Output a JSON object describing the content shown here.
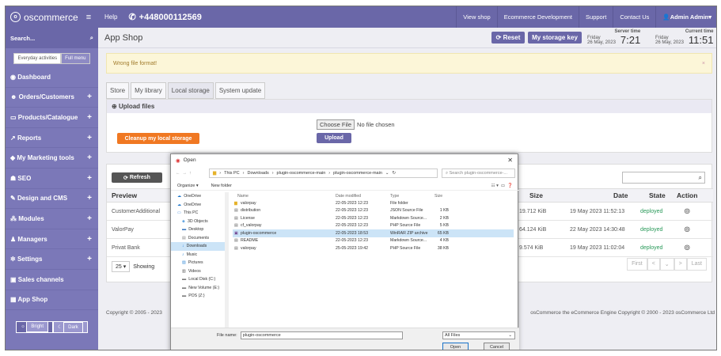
{
  "topbar": {
    "brand": "oscommerce",
    "menu_icon": "hamburger-icon",
    "help": "Help",
    "phone": "+448000112569",
    "links": [
      "View shop",
      "Ecommerce Development",
      "Support",
      "Contact Us",
      "Admin Admin"
    ]
  },
  "sidebar": {
    "search": "Search...",
    "activity_tabs": [
      "Everyday activities",
      "Full menu"
    ],
    "items": [
      {
        "label": "Dashboard",
        "icon": "dashboard-icon",
        "plus": false
      },
      {
        "label": "Orders/Customers",
        "icon": "users-icon",
        "plus": true
      },
      {
        "label": "Products/Catalogue",
        "icon": "folder-icon",
        "plus": true
      },
      {
        "label": "Reports",
        "icon": "chart-icon",
        "plus": true
      },
      {
        "label": "My Marketing tools",
        "icon": "tag-icon",
        "plus": true
      },
      {
        "label": "SEO",
        "icon": "sitemap-icon",
        "plus": true
      },
      {
        "label": "Design and CMS",
        "icon": "brush-icon",
        "plus": true
      },
      {
        "label": "Modules",
        "icon": "modules-icon",
        "plus": true
      },
      {
        "label": "Managers",
        "icon": "user-icon",
        "plus": true
      },
      {
        "label": "Settings",
        "icon": "gears-icon",
        "plus": true
      },
      {
        "label": "Sales channels",
        "icon": "monitor-icon",
        "plus": false
      },
      {
        "label": "App Shop",
        "icon": "shop-icon",
        "plus": false
      }
    ],
    "theme": [
      "Bright",
      "Dark"
    ]
  },
  "header": {
    "title": "App Shop",
    "reset": "Reset",
    "storage_key": "My storage key",
    "server_time": {
      "label": "Server time",
      "day": "Friday",
      "date": "26 May, 2023",
      "time": "7:21"
    },
    "current_time": {
      "label": "Current time",
      "day": "Friday",
      "date": "26 May, 2023",
      "time": "11:51"
    }
  },
  "warning": "Wrong file format!",
  "tabs": [
    "Store",
    "My library",
    "Local storage",
    "System update"
  ],
  "upload": {
    "title": "Upload files",
    "cleanup": "Cleanup my local storage",
    "choose": "Choose File",
    "no_file": "No file chosen",
    "upload_btn": "Upload"
  },
  "list": {
    "refresh": "Refresh",
    "columns": {
      "preview": "Preview",
      "size": "Size",
      "date": "Date",
      "state": "State",
      "action": "Action"
    },
    "rows": [
      {
        "name": "CustomerAdditional",
        "size": "19.712 KiB",
        "date": "19 May 2023 11:52:13",
        "state": "deployed"
      },
      {
        "name": "ValorPay",
        "size": "64.124 KiB",
        "date": "22 May 2023 14:30:48",
        "state": "deployed"
      },
      {
        "name": "Privat Bank",
        "size": "9.574 KiB",
        "date": "19 May 2023 11:02:04",
        "state": "deployed"
      }
    ],
    "per_page": "25",
    "showing": "Showing",
    "pager": [
      "First",
      "<",
      ">",
      "Last"
    ]
  },
  "footer": {
    "left": "Copyright © 2005 - 2023",
    "right": "osCommerce the eCommerce Engine Copyright © 2000 - 2023 osCommerce Ltd"
  },
  "dialog": {
    "title": "Open",
    "path": [
      "This PC",
      "Downloads",
      "plugin-oscommerce-main",
      "plugin-oscommerce-main"
    ],
    "search": "Search plugin-oscommerce-...",
    "organize": "Organize",
    "new_folder": "New folder",
    "side": [
      {
        "label": "OneDrive",
        "sel": false
      },
      {
        "label": "OneDrive",
        "sel": false
      },
      {
        "label": "This PC",
        "sel": false
      },
      {
        "label": "3D Objects",
        "sel": false
      },
      {
        "label": "Desktop",
        "sel": false
      },
      {
        "label": "Documents",
        "sel": false
      },
      {
        "label": "Downloads",
        "sel": true
      },
      {
        "label": "Music",
        "sel": false
      },
      {
        "label": "Pictures",
        "sel": false
      },
      {
        "label": "Videos",
        "sel": false
      },
      {
        "label": "Local Disk (C:)",
        "sel": false
      },
      {
        "label": "New Volume (E:)",
        "sel": false
      },
      {
        "label": "POS (Z:)",
        "sel": false
      }
    ],
    "columns": {
      "name": "Name",
      "modified": "Date modified",
      "type": "Type",
      "size": "Size"
    },
    "files": [
      {
        "name": "valorpay",
        "modified": "22-05-2023 12:23",
        "type": "File folder",
        "size": "",
        "sel": false
      },
      {
        "name": "distribution",
        "modified": "22-05-2023 12:23",
        "type": "JSON Source File",
        "size": "1 KB",
        "sel": false
      },
      {
        "name": "License",
        "modified": "22-05-2023 12:23",
        "type": "Markdown Source...",
        "size": "2 KB",
        "sel": false
      },
      {
        "name": "cf_valorpay",
        "modified": "22-05-2023 12:23",
        "type": "PHP Source File",
        "size": "5 KB",
        "sel": false
      },
      {
        "name": "plugin-oscommerce",
        "modified": "22-05-2023 18:53",
        "type": "WinRAR ZIP archive",
        "size": "65 KB",
        "sel": true
      },
      {
        "name": "README",
        "modified": "22-05-2023 12:23",
        "type": "Markdown Source...",
        "size": "4 KB",
        "sel": false
      },
      {
        "name": "valorpay",
        "modified": "25-05-2023 19:42",
        "type": "PHP Source File",
        "size": "38 KB",
        "sel": false
      }
    ],
    "file_name_label": "File name:",
    "file_name": "plugin-oscommerce",
    "file_type": "All Files",
    "open": "Open",
    "cancel": "Cancel"
  }
}
